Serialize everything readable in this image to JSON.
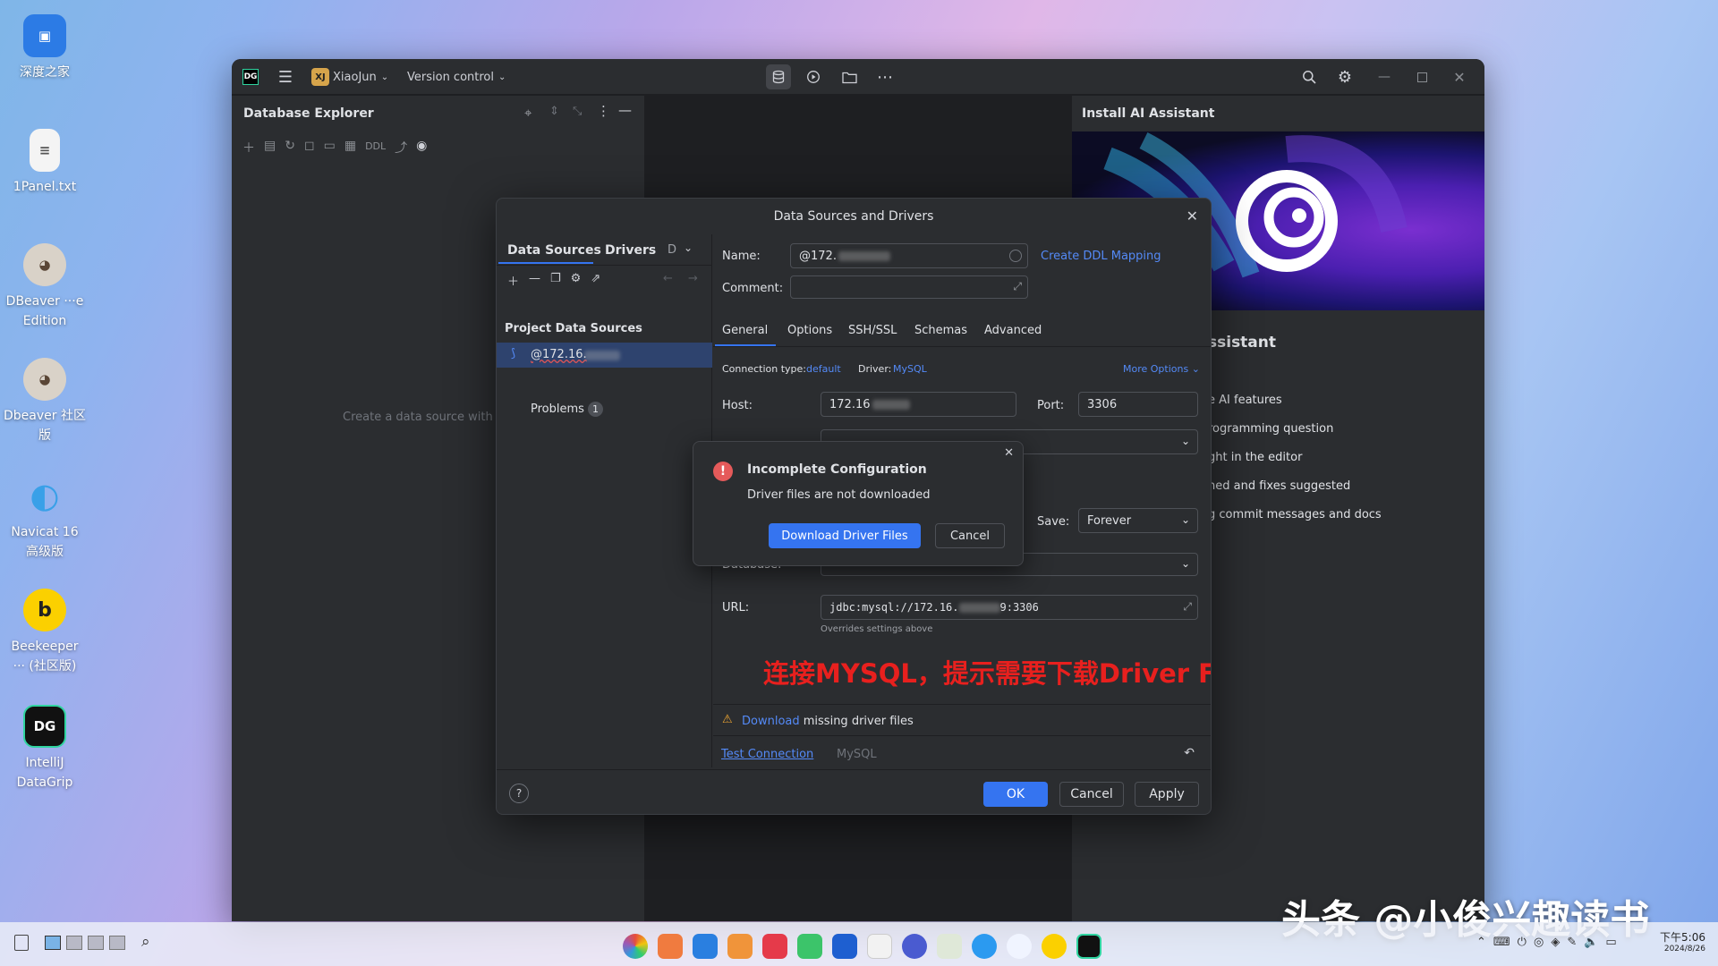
{
  "desktop": {
    "icons": [
      {
        "label": "深度之家",
        "name": "deepin-home",
        "color": "#2c7be5",
        "glyph": "▣"
      },
      {
        "label": "1Panel.txt",
        "name": "text-file",
        "color": "#f4f4f4",
        "glyph": "≡"
      },
      {
        "label": "DBeaver ···e Edition",
        "name": "dbeaver-ee",
        "color": "#6b5a4e",
        "glyph": "🦫"
      },
      {
        "label": "Dbeaver 社区版",
        "name": "dbeaver-ce",
        "color": "#6b5a4e",
        "glyph": "🦫"
      },
      {
        "label": "Navicat 16 高级版",
        "name": "navicat",
        "color": "#f2f6ff",
        "glyph": "◐"
      },
      {
        "label": "Beekeeper ··· (社区版)",
        "name": "beekeeper",
        "color": "#fbd000",
        "glyph": "b"
      },
      {
        "label": "IntelliJ DataGrip",
        "name": "datagrip",
        "color": "#111111",
        "glyph": "DG"
      }
    ]
  },
  "ide": {
    "logo": "DG",
    "project_badge": "XJ",
    "project": "XiaoJun",
    "vcs": "Version control",
    "db_explorer_title": "Database Explorer",
    "db_explorer_hint": "Create a data source with Alt",
    "ai_title": "Install AI Assistant",
    "ai_heading": "ssistant",
    "ai_features": [
      "e AI features",
      "rogramming question",
      "ght in the editor",
      "ned and fixes suggested",
      "g commit messages and docs"
    ]
  },
  "dialog": {
    "title": "Data Sources and Drivers",
    "tabs": [
      "Data Sources",
      "Drivers",
      "D"
    ],
    "section": "Project Data Sources",
    "datasource": "@172.16.",
    "problems_label": "Problems",
    "problems_count": "1",
    "name_label": "Name:",
    "name_value": "@172.",
    "ddl_link": "Create DDL Mapping",
    "comment_label": "Comment:",
    "conf_tabs": [
      "General",
      "Options",
      "SSH/SSL",
      "Schemas",
      "Advanced"
    ],
    "conn_type_label": "Connection type:",
    "conn_type_value": "default",
    "driver_label": "Driver:",
    "driver_value": "MySQL",
    "more_options": "More Options",
    "host_label": "Host:",
    "host_value": "172.16",
    "port_label": "Port:",
    "port_value": "3306",
    "save_label": "Save:",
    "save_value": "Forever",
    "database_label": "Database:",
    "url_label": "URL:",
    "url_prefix": "jdbc:mysql://172.16.",
    "url_suffix": "9:3306",
    "url_hint": "Overrides settings above",
    "annotation": "连接MYSQL，提示需要下载Driver File",
    "warn_link": "Download",
    "warn_text": " missing driver files",
    "test_connection": "Test Connection",
    "test_driver": "MySQL",
    "ok": "OK",
    "cancel": "Cancel",
    "apply": "Apply"
  },
  "popup": {
    "title": "Incomplete Configuration",
    "message": "Driver files are not downloaded",
    "download": "Download Driver Files",
    "cancel": "Cancel"
  },
  "watermark": "头条 @小俊兴趣读书",
  "clock": {
    "time": "下午5:06",
    "date": "2024/8/26"
  }
}
